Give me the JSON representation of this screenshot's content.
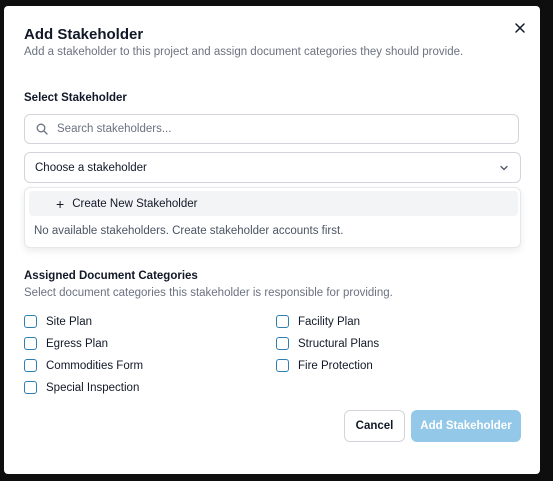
{
  "dialog": {
    "title": "Add Stakeholder",
    "subtitle": "Add a stakeholder to this project and assign document categories they should provide."
  },
  "select_section": {
    "label": "Select Stakeholder",
    "search_placeholder": "Search stakeholders...",
    "select_value": "Choose a stakeholder",
    "create_label": "Create New Stakeholder",
    "empty_message": "No available stakeholders. Create stakeholder accounts first."
  },
  "categories": {
    "title": "Assigned Document Categories",
    "subtitle": "Select document categories this stakeholder is responsible for providing.",
    "items": [
      {
        "label": "Site Plan",
        "checked": false
      },
      {
        "label": "Egress Plan",
        "checked": false
      },
      {
        "label": "Commodities Form",
        "checked": false
      },
      {
        "label": "Special Inspection",
        "checked": false
      },
      {
        "label": "Facility Plan",
        "checked": false
      },
      {
        "label": "Structural Plans",
        "checked": false
      },
      {
        "label": "Fire Protection",
        "checked": false
      }
    ]
  },
  "buttons": {
    "cancel": "Cancel",
    "add": "Add Stakeholder"
  },
  "colors": {
    "accent": "#2f7fb0",
    "primary_disabled": "#93c8e8"
  },
  "icons": [
    "close-icon",
    "search-icon",
    "chevron-down-icon",
    "plus-icon"
  ]
}
